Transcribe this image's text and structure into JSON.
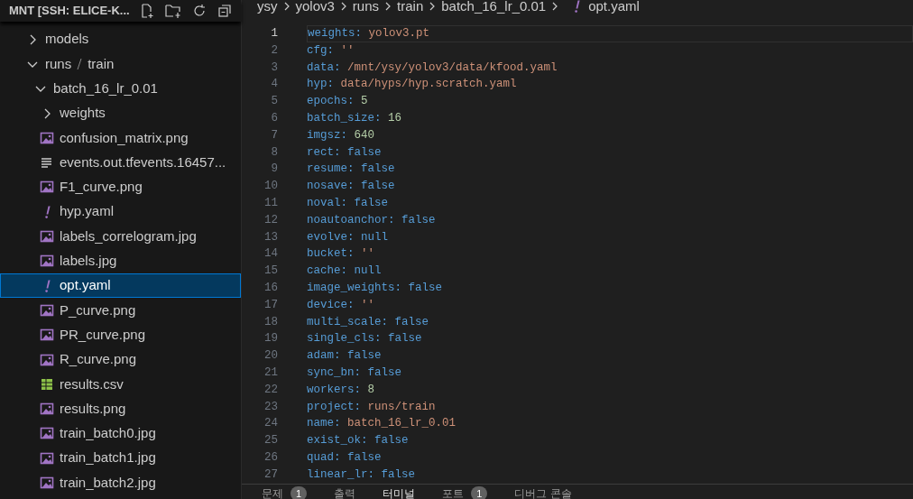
{
  "sidebar": {
    "title": "MNT [SSH: ELICE-K...",
    "tree": [
      {
        "label": "models",
        "kind": "folder",
        "expanded": false,
        "selected": false
      },
      {
        "label": "runs",
        "label_2": "train",
        "kind": "folder",
        "expanded": true,
        "selected": false,
        "children": [
          {
            "label": "batch_16_lr_0.01",
            "kind": "folder",
            "expanded": true,
            "selected": false,
            "children": [
              {
                "label": "weights",
                "kind": "folder",
                "expanded": false,
                "selected": false
              },
              {
                "label": "confusion_matrix.png",
                "kind": "image",
                "selected": false
              },
              {
                "label": "events.out.tfevents.16457...",
                "kind": "text",
                "selected": false
              },
              {
                "label": "F1_curve.png",
                "kind": "image",
                "selected": false
              },
              {
                "label": "hyp.yaml",
                "kind": "yaml",
                "selected": false
              },
              {
                "label": "labels_correlogram.jpg",
                "kind": "image",
                "selected": false
              },
              {
                "label": "labels.jpg",
                "kind": "image",
                "selected": false
              },
              {
                "label": "opt.yaml",
                "kind": "yaml",
                "selected": true
              },
              {
                "label": "P_curve.png",
                "kind": "image",
                "selected": false
              },
              {
                "label": "PR_curve.png",
                "kind": "image",
                "selected": false
              },
              {
                "label": "R_curve.png",
                "kind": "image",
                "selected": false
              },
              {
                "label": "results.csv",
                "kind": "csv",
                "selected": false
              },
              {
                "label": "results.png",
                "kind": "image",
                "selected": false
              },
              {
                "label": "train_batch0.jpg",
                "kind": "image",
                "selected": false
              },
              {
                "label": "train_batch1.jpg",
                "kind": "image",
                "selected": false
              },
              {
                "label": "train_batch2.jpg",
                "kind": "image",
                "selected": false
              }
            ]
          }
        ]
      }
    ]
  },
  "breadcrumb": [
    "ysy",
    "yolov3",
    "runs",
    "train",
    "batch_16_lr_0.01",
    "opt.yaml"
  ],
  "editor": {
    "lines": [
      {
        "number": "1",
        "key": "weights:",
        "value": "yolov3.pt",
        "kind": "string",
        "current": true
      },
      {
        "number": "2",
        "key": "cfg:",
        "value": "''",
        "kind": "string",
        "current": false
      },
      {
        "number": "3",
        "key": "data:",
        "value": "/mnt/ysy/yolov3/data/kfood.yaml",
        "kind": "string",
        "current": false
      },
      {
        "number": "4",
        "key": "hyp:",
        "value": "data/hyps/hyp.scratch.yaml",
        "kind": "string",
        "current": false
      },
      {
        "number": "5",
        "key": "epochs:",
        "value": "5",
        "kind": "number",
        "current": false
      },
      {
        "number": "6",
        "key": "batch_size:",
        "value": "16",
        "kind": "number",
        "current": false
      },
      {
        "number": "7",
        "key": "imgsz:",
        "value": "640",
        "kind": "number",
        "current": false
      },
      {
        "number": "8",
        "key": "rect:",
        "value": "false",
        "kind": "keyword",
        "current": false
      },
      {
        "number": "9",
        "key": "resume:",
        "value": "false",
        "kind": "keyword",
        "current": false
      },
      {
        "number": "10",
        "key": "nosave:",
        "value": "false",
        "kind": "keyword",
        "current": false
      },
      {
        "number": "11",
        "key": "noval:",
        "value": "false",
        "kind": "keyword",
        "current": false
      },
      {
        "number": "12",
        "key": "noautoanchor:",
        "value": "false",
        "kind": "keyword",
        "current": false
      },
      {
        "number": "13",
        "key": "evolve:",
        "value": "null",
        "kind": "keyword",
        "current": false
      },
      {
        "number": "14",
        "key": "bucket:",
        "value": "''",
        "kind": "string",
        "current": false
      },
      {
        "number": "15",
        "key": "cache:",
        "value": "null",
        "kind": "keyword",
        "current": false
      },
      {
        "number": "16",
        "key": "image_weights:",
        "value": "false",
        "kind": "keyword",
        "current": false
      },
      {
        "number": "17",
        "key": "device:",
        "value": "''",
        "kind": "string",
        "current": false
      },
      {
        "number": "18",
        "key": "multi_scale:",
        "value": "false",
        "kind": "keyword",
        "current": false
      },
      {
        "number": "19",
        "key": "single_cls:",
        "value": "false",
        "kind": "keyword",
        "current": false
      },
      {
        "number": "20",
        "key": "adam:",
        "value": "false",
        "kind": "keyword",
        "current": false
      },
      {
        "number": "21",
        "key": "sync_bn:",
        "value": "false",
        "kind": "keyword",
        "current": false
      },
      {
        "number": "22",
        "key": "workers:",
        "value": "8",
        "kind": "number",
        "current": false
      },
      {
        "number": "23",
        "key": "project:",
        "value": "runs/train",
        "kind": "string",
        "current": false
      },
      {
        "number": "24",
        "key": "name:",
        "value": "batch_16_lr_0.01",
        "kind": "string",
        "current": false
      },
      {
        "number": "25",
        "key": "exist_ok:",
        "value": "false",
        "kind": "keyword",
        "current": false
      },
      {
        "number": "26",
        "key": "quad:",
        "value": "false",
        "kind": "keyword",
        "current": false
      },
      {
        "number": "27",
        "key": "linear_lr:",
        "value": "false",
        "kind": "keyword",
        "current": false
      }
    ]
  },
  "panel_tabs": [
    {
      "label": "문제",
      "badge": "1",
      "selected": false
    },
    {
      "label": "출력",
      "selected": false
    },
    {
      "label": "터미널",
      "selected": true
    },
    {
      "label": "포트",
      "badge": "1",
      "selected": false
    },
    {
      "label": "디버그 콘솔",
      "selected": false
    }
  ]
}
